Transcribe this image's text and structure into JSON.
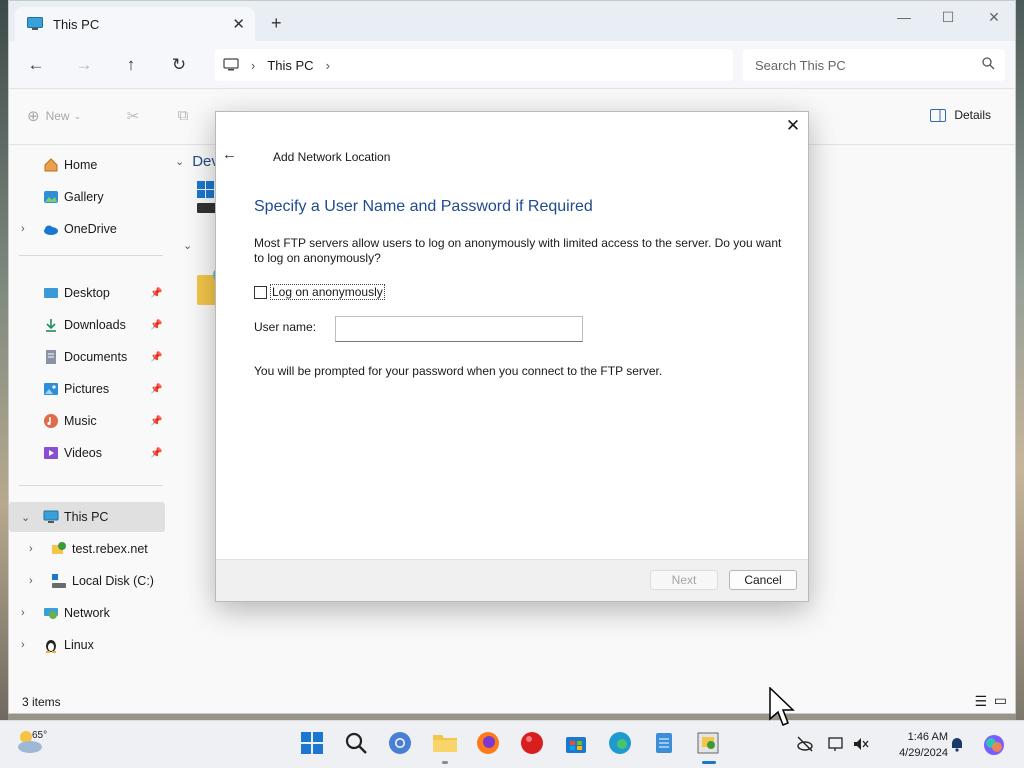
{
  "window": {
    "tab_title": "This PC",
    "new_tab": "+",
    "minimize": "—",
    "maximize": "☐",
    "close": "✕"
  },
  "address": {
    "path_label": "This PC",
    "search_placeholder": "Search This PC"
  },
  "toolbar": {
    "new_label": "New",
    "details_label": "Details"
  },
  "sidebar": {
    "items": [
      {
        "label": "Home",
        "icon": "home-icon"
      },
      {
        "label": "Gallery",
        "icon": "gallery-icon"
      },
      {
        "label": "OneDrive",
        "icon": "onedrive-icon"
      },
      {
        "label": "Desktop",
        "icon": "desktop-icon"
      },
      {
        "label": "Downloads",
        "icon": "downloads-icon"
      },
      {
        "label": "Documents",
        "icon": "documents-icon"
      },
      {
        "label": "Pictures",
        "icon": "pictures-icon"
      },
      {
        "label": "Music",
        "icon": "music-icon"
      },
      {
        "label": "Videos",
        "icon": "videos-icon"
      },
      {
        "label": "This PC",
        "icon": "this-pc-icon"
      },
      {
        "label": "test.rebex.net",
        "icon": "network-folder-icon"
      },
      {
        "label": "Local Disk (C:)",
        "icon": "disk-icon"
      },
      {
        "label": "Network",
        "icon": "network-icon"
      },
      {
        "label": "Linux",
        "icon": "linux-icon"
      }
    ]
  },
  "content": {
    "group_header": "Dev"
  },
  "status": {
    "item_count": "3 items"
  },
  "dialog": {
    "wizard_title": "Add Network Location",
    "heading": "Specify a User Name and Password if Required",
    "description": "Most FTP servers allow users to log on anonymously with limited access to the server.  Do you want to log on anonymously?",
    "checkbox_label": "Log on anonymously",
    "checkbox_checked": false,
    "username_label": "User name:",
    "username_value": "",
    "note": "You will be prompted for your password when you connect to the FTP server.",
    "next_label": "Next",
    "cancel_label": "Cancel"
  },
  "taskbar": {
    "weather_temp": "65°",
    "time": "1:46 AM",
    "date": "4/29/2024"
  },
  "colors": {
    "accent": "#1c78c7",
    "heading_blue": "#1f4b91"
  }
}
